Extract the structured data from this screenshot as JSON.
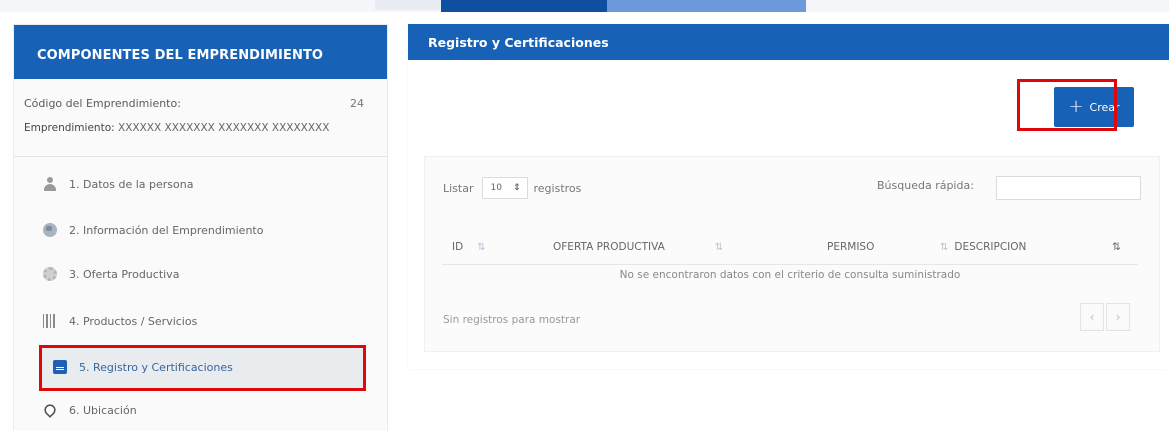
{
  "sidebar": {
    "title": "COMPONENTES DEL EMPRENDIMIENTO",
    "code_label": "Código del Emprendimiento:",
    "code_value": "24",
    "name_label": "Emprendimiento:",
    "name_value": "XXXXXX XXXXXXX XXXXXXX XXXXXXXX",
    "items": [
      {
        "label": "1. Datos de la persona",
        "icon": "person-icon"
      },
      {
        "label": "2. Información del Emprendimiento",
        "icon": "globe-icon"
      },
      {
        "label": "3. Oferta Productiva",
        "icon": "gear-icon"
      },
      {
        "label": "4. Productos / Servicios",
        "icon": "barcode-icon"
      },
      {
        "label": "5. Registro y Certificaciones",
        "icon": "document-icon",
        "active": true
      },
      {
        "label": "6. Ubicación",
        "icon": "map-pin-icon"
      }
    ]
  },
  "main": {
    "title": "Registro y Certificaciones",
    "create_button": "Crear",
    "create_icon": "+",
    "list_label": "Listar",
    "page_size": "10",
    "records_label": "registros",
    "search_label": "Búsqueda rápida:",
    "search_value": "",
    "columns": [
      "ID",
      "OFERTA PRODUCTIVA",
      "PERMISO",
      "DESCRIPCION"
    ],
    "sort_icon": "⇅",
    "empty_message": "No se encontraron datos con el criterio de consulta suministrado",
    "no_rows_text": "Sin registros para mostrar",
    "prev": "‹",
    "next": "›"
  },
  "colors": {
    "header_blue": "#1762b6",
    "highlight_red": "#e0070b"
  }
}
